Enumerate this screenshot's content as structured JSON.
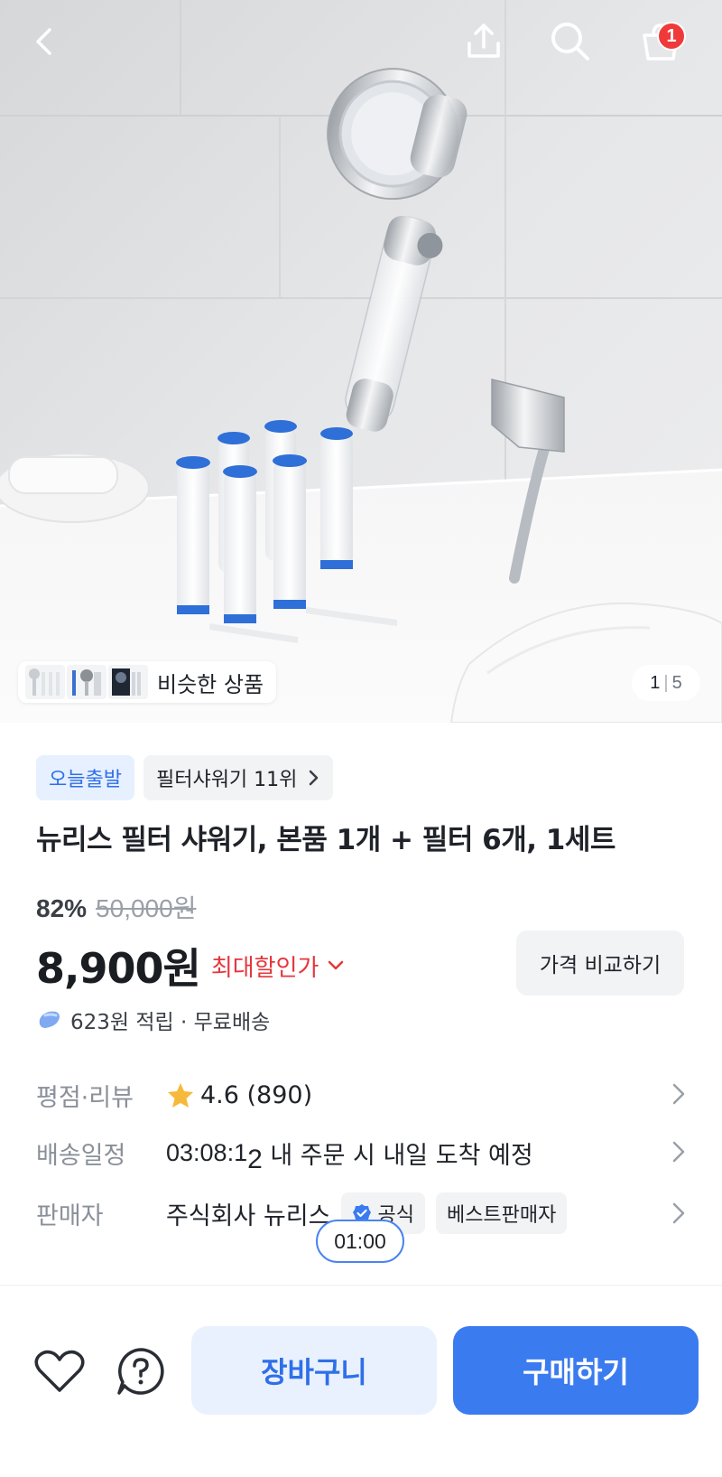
{
  "header": {
    "back_icon": "chevron-left-icon",
    "share_icon": "share-icon",
    "search_icon": "search-icon",
    "cart_icon": "shopping-bag-icon",
    "cart_count": "1"
  },
  "gallery": {
    "similar_label": "비슷한 상품",
    "current": "1",
    "separator": "|",
    "total": "5"
  },
  "product": {
    "badge_today": "오늘출발",
    "rank_label": "필터샤워기 11위",
    "title": "뉴리스 필터 샤워기, 본품 1개 + 필터 6개, 1세트",
    "discount_rate": "82%",
    "original_price": "50,000원",
    "price": "8,900원",
    "max_discount_label": "최대할인가",
    "compare_label": "가격 비교하기",
    "points_text": "623원 적립 · 무료배송"
  },
  "details": {
    "rating_key": "평점·리뷰",
    "rating_value": "4.6 (890)",
    "delivery_key": "배송일정",
    "delivery_timer_main": "03:08:1",
    "delivery_timer_last": "2",
    "delivery_text": " 내 주문 시 내일 도착 예정",
    "seller_key": "판매자",
    "seller_name": "주식회사 뉴리스",
    "seller_badge_official": "공식",
    "seller_badge_best": "베스트판매자"
  },
  "time_pill": "01:00",
  "bottom_bar": {
    "wishlist_icon": "heart-icon",
    "inquiry_icon": "question-icon",
    "cart_label": "장바구니",
    "buy_label": "구매하기"
  },
  "colors": {
    "accent": "#3b7bf0",
    "accent_light": "#e9f1ff",
    "discount_red": "#e5363c",
    "badge_red": "#f03a3a"
  }
}
